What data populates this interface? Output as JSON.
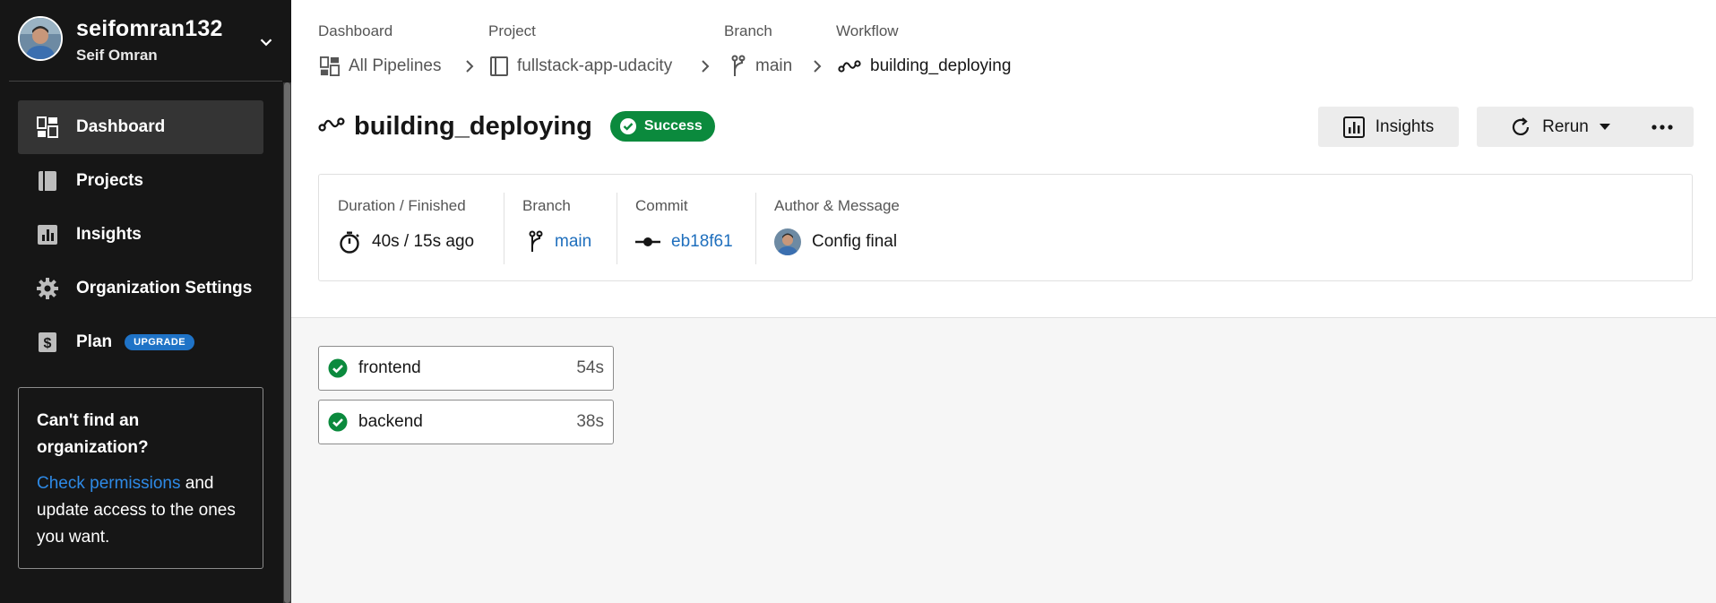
{
  "user": {
    "handle": "seifomran132",
    "name": "Seif Omran"
  },
  "sidebar": {
    "items": [
      {
        "label": "Dashboard",
        "icon": "dashboard-icon",
        "active": true
      },
      {
        "label": "Projects",
        "icon": "book-icon"
      },
      {
        "label": "Insights",
        "icon": "bar-chart-icon"
      },
      {
        "label": "Organization Settings",
        "icon": "gear-icon"
      },
      {
        "label": "Plan",
        "icon": "dollar-icon",
        "badge": "UPGRADE"
      }
    ],
    "org_box": {
      "title": "Can't find an organization?",
      "link": "Check permissions",
      "text": " and update access to the ones you want."
    }
  },
  "breadcrumb": {
    "labels": [
      "Dashboard",
      "Project",
      "Branch",
      "Workflow"
    ],
    "items": [
      "All Pipelines",
      "fullstack-app-udacity",
      "main",
      "building_deploying"
    ]
  },
  "workflow": {
    "title": "building_deploying",
    "status": "Success"
  },
  "toolbar": {
    "insights": "Insights",
    "rerun": "Rerun"
  },
  "summary": {
    "duration_label": "Duration / Finished",
    "duration_value": "40s / 15s ago",
    "branch_label": "Branch",
    "branch_value": "main",
    "commit_label": "Commit",
    "commit_value": "eb18f61",
    "author_label": "Author & Message",
    "author_message": "Config final"
  },
  "jobs": [
    {
      "name": "frontend",
      "duration": "54s",
      "status": "success"
    },
    {
      "name": "backend",
      "duration": "38s",
      "status": "success"
    }
  ],
  "colors": {
    "success": "#0b8a3d",
    "link": "#1f6fbd",
    "sidebar_bg": "#161616",
    "upgrade": "#1f73c7"
  }
}
